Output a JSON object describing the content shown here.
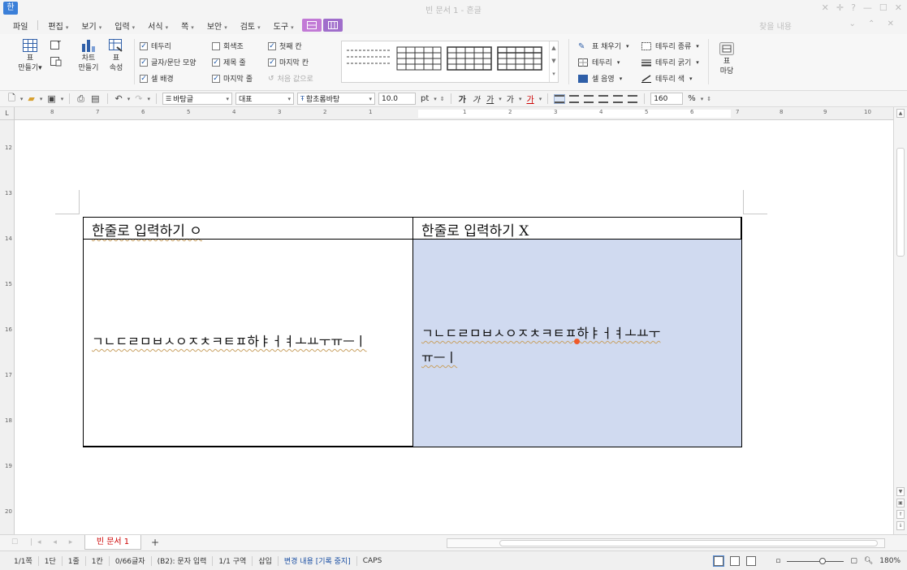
{
  "window": {
    "title": "빈 문서 1 - 흔글",
    "logo_text": "한",
    "controls": [
      "✕",
      "✛",
      "?",
      "—",
      "☐",
      "✕"
    ]
  },
  "menu": {
    "items": [
      {
        "label": "파일",
        "arrow": ""
      },
      {
        "label": "편집",
        "arrow": "▾"
      },
      {
        "label": "보기",
        "arrow": "▾"
      },
      {
        "label": "입력",
        "arrow": "▾"
      },
      {
        "label": "서식",
        "arrow": "▾"
      },
      {
        "label": "쪽",
        "arrow": "▾"
      },
      {
        "label": "보안",
        "arrow": "▾"
      },
      {
        "label": "검토",
        "arrow": "▾"
      },
      {
        "label": "도구",
        "arrow": "▾"
      }
    ],
    "search_placeholder": "찾을 내용",
    "right_controls": "⌄ ⌃ ✕"
  },
  "ribbon": {
    "table_make": {
      "line1": "표",
      "line2": "만들기▾"
    },
    "chart": {
      "line1": "차트",
      "line2": "만들기"
    },
    "table_props": {
      "line1": "표",
      "line2": "속성"
    },
    "checks": [
      {
        "label": "테두리",
        "checked": true
      },
      {
        "label": "글자/문단 모양",
        "checked": true
      },
      {
        "label": "셀 배경",
        "checked": true
      },
      {
        "label": "회색조",
        "checked": false
      },
      {
        "label": "제목 줄",
        "checked": true
      },
      {
        "label": "마지막 줄",
        "checked": true
      },
      {
        "label": "첫째 칸",
        "checked": true
      },
      {
        "label": "마지막 칸",
        "checked": true
      }
    ],
    "reset_label": "처음 값으로",
    "right_tools": [
      {
        "label": "표 채우기",
        "arrow": "▾"
      },
      {
        "label": "테두리",
        "arrow": "▾"
      },
      {
        "label": "셀 음영",
        "arrow": "▾"
      },
      {
        "label": "테두리 종류",
        "arrow": "▾"
      },
      {
        "label": "테두리 굵기",
        "arrow": "▾"
      },
      {
        "label": "테두리 색",
        "arrow": "▾"
      }
    ],
    "madang": {
      "line1": "표",
      "line2": "마당"
    }
  },
  "format": {
    "style": "바탕글",
    "script": "대표",
    "font": "함초롬바탕",
    "size": "10.0",
    "unit": "pt",
    "bold": "가",
    "italic": "가",
    "underline": "가",
    "strike": "가",
    "color_text": "가",
    "zoom": "160",
    "zoom_unit": "%"
  },
  "ruler": {
    "h_numbers": [
      "8",
      "7",
      "6",
      "5",
      "4",
      "3",
      "2",
      "1",
      "1",
      "2",
      "3",
      "4",
      "5",
      "6",
      "7",
      "8",
      "9",
      "10"
    ],
    "v_numbers": [
      "12",
      "13",
      "14",
      "15",
      "16",
      "17",
      "18",
      "19",
      "20"
    ]
  },
  "document": {
    "cells": {
      "head_left": "한줄로 입력하기 ㅇ",
      "head_right": "한줄로 입력하기 X",
      "body_left": "ㄱㄴㄷㄹㅁㅂㅅㅇㅈㅊㅋㅌㅍ하ㅑㅓㅕㅗㅛㅜㅠㅡㅣ",
      "body_right_line1": "ㄱㄴㄷㄹㅁㅂㅅㅇㅈㅊㅋㅌㅍ하ㅑㅓㅕㅗㅛㅜ",
      "body_right_line2": "ㅠㅡㅣ"
    },
    "selected_cell_color": "#d0daf0"
  },
  "tabs": {
    "doc_tab": "빈 문서 1",
    "add": "+"
  },
  "status": {
    "page": "1/1쪽",
    "column": "1단",
    "line": "1줄",
    "col": "1칸",
    "chars": "0/66글자",
    "cell": "(B2): 문자 입력",
    "section": "1/1 구역",
    "insert": "삽입",
    "track": "변경 내용 [기록 중지]",
    "caps": "CAPS",
    "zoom": "180%"
  }
}
